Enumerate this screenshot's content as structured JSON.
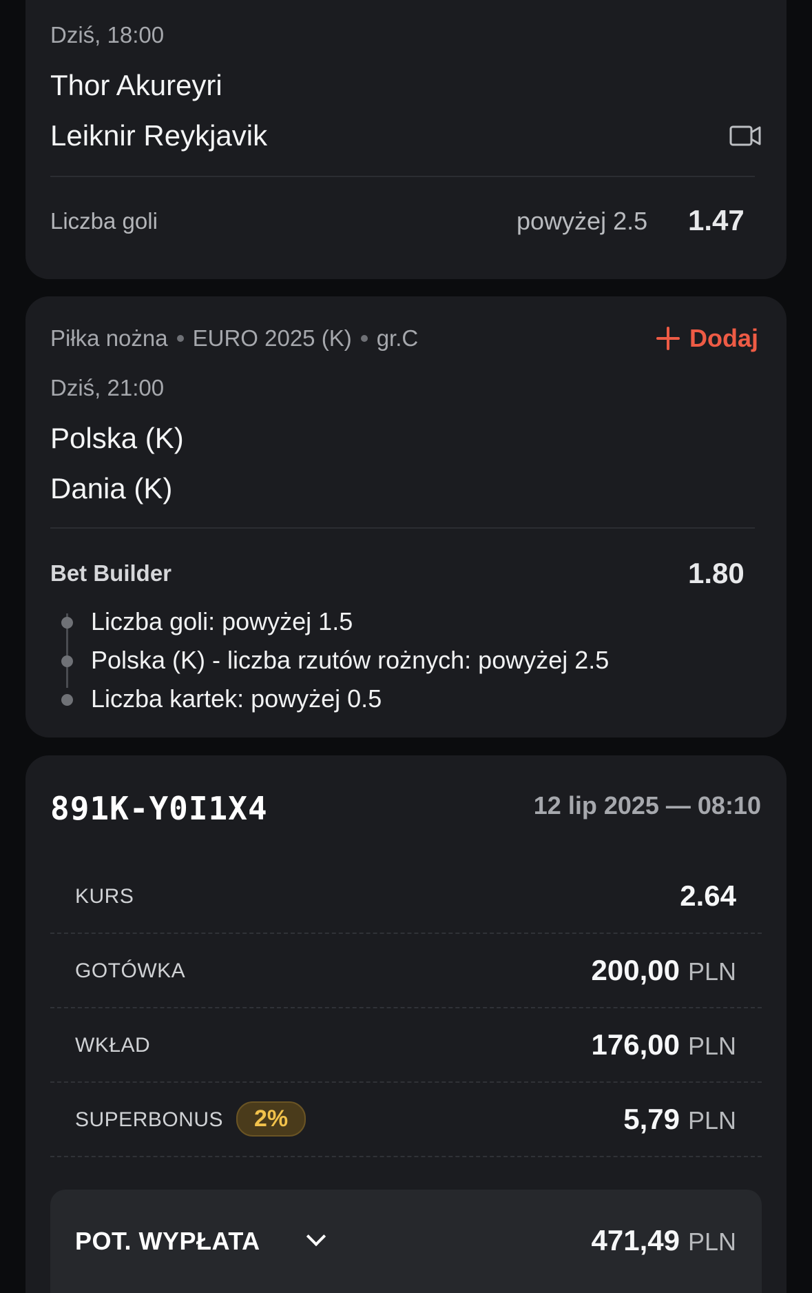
{
  "match1": {
    "datetime": "Dziś, 18:00",
    "home": "Thor Akureyri",
    "away": "Leiknir Reykjavik",
    "market_label": "Liczba goli",
    "selection": "powyżej 2.5",
    "odds": "1.47"
  },
  "match2": {
    "breadcrumb": {
      "sport": "Piłka nożna",
      "league": "EURO 2025 (K)",
      "group": "gr.C"
    },
    "add_label": "Dodaj",
    "datetime": "Dziś, 21:00",
    "home": "Polska (K)",
    "away": "Dania (K)",
    "bet_builder_title": "Bet Builder",
    "odds": "1.80",
    "items": [
      "Liczba goli: powyżej 1.5",
      "Polska (K) - liczba rzutów rożnych: powyżej 2.5",
      "Liczba kartek: powyżej 0.5"
    ]
  },
  "ticket": {
    "id": "891K-Y0I1X4",
    "date": "12 lip 2025 — 08:10",
    "rows": {
      "kurs": {
        "label": "KURS",
        "value": "2.64"
      },
      "gotowka": {
        "label": "GOTÓWKA",
        "value": "200,00",
        "currency": "PLN"
      },
      "wklad": {
        "label": "WKŁAD",
        "value": "176,00",
        "currency": "PLN"
      },
      "superbonus": {
        "label": "SUPERBONUS",
        "badge": "2%",
        "value": "5,79",
        "currency": "PLN"
      }
    },
    "payout": {
      "label": "POT. WYPŁATA",
      "value": "471,49",
      "currency": "PLN"
    }
  },
  "colors": {
    "background": "#0b0c0e",
    "card": "#1b1c20",
    "accent": "#ee5b45",
    "badge_bg": "#4a3b1b",
    "badge_text": "#f2c24b"
  },
  "icons": {
    "camera": "video-camera-icon",
    "plus": "plus-icon",
    "chevron": "chevron-down-icon"
  }
}
